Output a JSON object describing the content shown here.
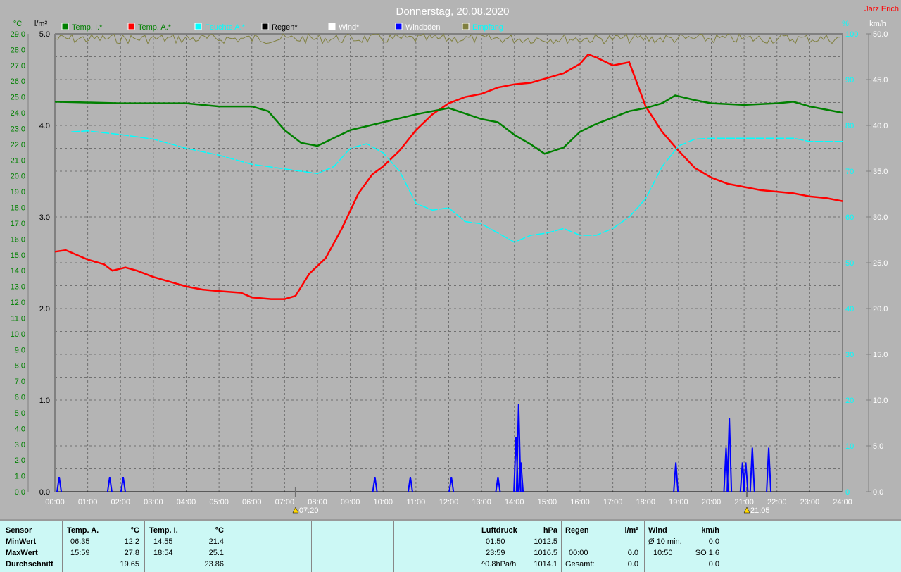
{
  "chart_data": {
    "type": "line",
    "title": "Donnerstag, 20.08.2020",
    "author": "Jarz Erich",
    "x_range_hours": [
      0,
      24
    ],
    "x_ticks": [
      "00:00",
      "01:00",
      "02:00",
      "03:00",
      "04:00",
      "05:00",
      "06:00",
      "07:00",
      "08:00",
      "09:00",
      "10:00",
      "11:00",
      "12:00",
      "13:00",
      "14:00",
      "15:00",
      "16:00",
      "17:00",
      "18:00",
      "19:00",
      "20:00",
      "21:00",
      "22:00",
      "23:00",
      "24:00"
    ],
    "axes": {
      "temp": {
        "unit": "°C",
        "range": [
          0,
          29
        ],
        "ticks": [
          "29.0",
          "28.0",
          "27.0",
          "26.0",
          "25.0",
          "24.0",
          "23.0",
          "22.0",
          "21.0",
          "20.0",
          "19.0",
          "18.0",
          "17.0",
          "16.0",
          "15.0",
          "14.0",
          "13.0",
          "12.0",
          "11.0",
          "10.0",
          "9.0",
          "8.0",
          "7.0",
          "6.0",
          "5.0",
          "4.0",
          "3.0",
          "2.0",
          "1.0",
          "0.0"
        ],
        "color": "#008000"
      },
      "rain": {
        "unit": "l/m²",
        "range": [
          0,
          5
        ],
        "ticks": [
          "5.0",
          "4.0",
          "3.0",
          "2.0",
          "1.0",
          "0.0"
        ],
        "color": "#000000"
      },
      "humidity": {
        "unit": "%",
        "range": [
          0,
          100
        ],
        "ticks": [
          "100",
          "90",
          "80",
          "70",
          "60",
          "50",
          "40",
          "30",
          "20",
          "10",
          "0"
        ],
        "color": "#00ffff"
      },
      "wind": {
        "unit": "km/h",
        "range": [
          0,
          50
        ],
        "ticks": [
          "50.0",
          "45.0",
          "40.0",
          "35.0",
          "30.0",
          "25.0",
          "20.0",
          "15.0",
          "10.0",
          "5.0",
          "0.0"
        ],
        "color": "#ffffff"
      }
    },
    "legend": [
      {
        "label": "Temp. I.*",
        "color": "#008000",
        "text_color": "#008000"
      },
      {
        "label": "Temp. A.*",
        "color": "#ff0000",
        "text_color": "#008000"
      },
      {
        "label": "Feuchte A.*",
        "color": "#00ffff",
        "text_color": "#00ffff"
      },
      {
        "label": "Regen*",
        "color": "#000000",
        "text_color": "#000000"
      },
      {
        "label": "Wind*",
        "color": "#ffffff",
        "text_color": "#ffffff"
      },
      {
        "label": "Windböen",
        "color": "#0000ff",
        "text_color": "#ffffff"
      },
      {
        "label": "Empfang",
        "color": "#808040",
        "text_color": "#00ffff"
      }
    ],
    "series": [
      {
        "name": "Temp. A.",
        "axis": "temp",
        "color": "#ff0000",
        "x": [
          0,
          0.33,
          1,
          1.5,
          1.75,
          2.15,
          2.5,
          3,
          3.5,
          4,
          4.5,
          5,
          5.67,
          6,
          6.58,
          7,
          7.33,
          7.75,
          8.25,
          8.75,
          9.25,
          9.67,
          10,
          10.5,
          11,
          11.5,
          12,
          12.5,
          13,
          13.5,
          14,
          14.5,
          15,
          15.5,
          16,
          16.25,
          16.5,
          17,
          17.5,
          18,
          18.5,
          19,
          19.5,
          20,
          20.5,
          21,
          21.5,
          22,
          22.5,
          23,
          23.5,
          24
        ],
        "y": [
          15.2,
          15.3,
          14.7,
          14.4,
          14.0,
          14.2,
          14.0,
          13.6,
          13.3,
          13.0,
          12.8,
          12.7,
          12.6,
          12.3,
          12.2,
          12.2,
          12.4,
          13.8,
          14.8,
          16.7,
          18.9,
          20.1,
          20.6,
          21.6,
          22.9,
          23.9,
          24.6,
          25.0,
          25.2,
          25.6,
          25.8,
          25.9,
          26.2,
          26.5,
          27.1,
          27.7,
          27.5,
          27.0,
          27.2,
          24.4,
          22.8,
          21.6,
          20.5,
          19.9,
          19.5,
          19.3,
          19.1,
          19.0,
          18.9,
          18.7,
          18.6,
          18.4
        ]
      },
      {
        "name": "Temp. I.",
        "axis": "temp",
        "color": "#008000",
        "x": [
          0,
          2,
          4,
          5,
          6,
          6.5,
          7,
          7.5,
          8,
          8.5,
          9,
          10,
          11,
          12,
          13,
          13.5,
          14,
          14.5,
          14.92,
          15.5,
          16,
          16.5,
          17,
          17.5,
          18,
          18.5,
          18.9,
          19.5,
          20,
          21,
          22,
          22.5,
          23,
          24
        ],
        "y": [
          24.7,
          24.6,
          24.6,
          24.4,
          24.4,
          24.1,
          22.9,
          22.1,
          21.9,
          22.4,
          22.9,
          23.4,
          23.9,
          24.3,
          23.6,
          23.4,
          22.6,
          22.0,
          21.4,
          21.8,
          22.8,
          23.3,
          23.7,
          24.1,
          24.3,
          24.6,
          25.1,
          24.8,
          24.6,
          24.5,
          24.6,
          24.7,
          24.4,
          24.0
        ]
      },
      {
        "name": "Feuchte A.",
        "axis": "humidity",
        "color": "#00ffff",
        "x": [
          0.5,
          1,
          2,
          3,
          4,
          5,
          6,
          7,
          8,
          8.5,
          9,
          9.5,
          10,
          10.5,
          11,
          11.5,
          12,
          12.5,
          13,
          13.5,
          14,
          14.5,
          15,
          15.5,
          16,
          16.5,
          17,
          17.5,
          18,
          18.5,
          19,
          19.5,
          20,
          22.5,
          23,
          24
        ],
        "y": [
          78.6,
          78.8,
          78,
          77,
          75,
          73.5,
          71.5,
          70.5,
          69.5,
          71,
          75,
          76,
          74,
          70,
          63,
          61.5,
          62,
          59,
          58.5,
          56.5,
          54.5,
          56,
          56.5,
          57.5,
          56,
          56,
          57.5,
          60,
          64,
          71,
          75.5,
          77,
          77.2,
          77.2,
          76.5,
          76.5
        ]
      },
      {
        "name": "Windböen",
        "axis": "wind",
        "color": "#0000ff",
        "type": "spikes",
        "x": [
          0.13,
          1.67,
          2.08,
          9.75,
          10.83,
          12.08,
          13.5,
          14.05,
          14.13,
          14.2,
          18.92,
          20.45,
          20.55,
          20.95,
          21.05,
          21.25,
          21.75
        ],
        "y": [
          1.6,
          1.6,
          1.6,
          1.6,
          1.6,
          1.6,
          1.6,
          6.0,
          9.6,
          3.2,
          3.2,
          4.8,
          8.0,
          3.2,
          3.2,
          4.8,
          4.8
        ]
      }
    ],
    "sunrise": "07:20",
    "sunset": "21:05"
  },
  "table": {
    "sensor": {
      "header": "Sensor",
      "rows": [
        "MinWert",
        "MaxWert",
        "Durchschnitt"
      ]
    },
    "temp_a": {
      "header": "Temp. A.",
      "unit": "°C",
      "min_time": "06:35",
      "min": "12.2",
      "max_time": "15:59",
      "max": "27.8",
      "avg": "19.65"
    },
    "temp_i": {
      "header": "Temp. I.",
      "unit": "°C",
      "min_time": "14:55",
      "min": "21.4",
      "max_time": "18:54",
      "max": "25.1",
      "avg": "23.86"
    },
    "pressure": {
      "header": "Luftdruck",
      "unit": "hPa",
      "min_time": "01:50",
      "min": "1012.5",
      "max_time": "23:59",
      "max": "1016.5",
      "trend": "^0.8hPa/h",
      "avg": "1014.1"
    },
    "rain": {
      "header": "Regen",
      "unit": "l/m²",
      "time": "00:00",
      "value": "0.0",
      "total_label": "Gesamt:",
      "total": "0.0"
    },
    "wind": {
      "header": "Wind",
      "unit": "km/h",
      "avg_label": "Ø 10 min.",
      "avg": "0.0",
      "max_time": "10:50",
      "max": "SO 1.6",
      "third": "0.0"
    }
  }
}
